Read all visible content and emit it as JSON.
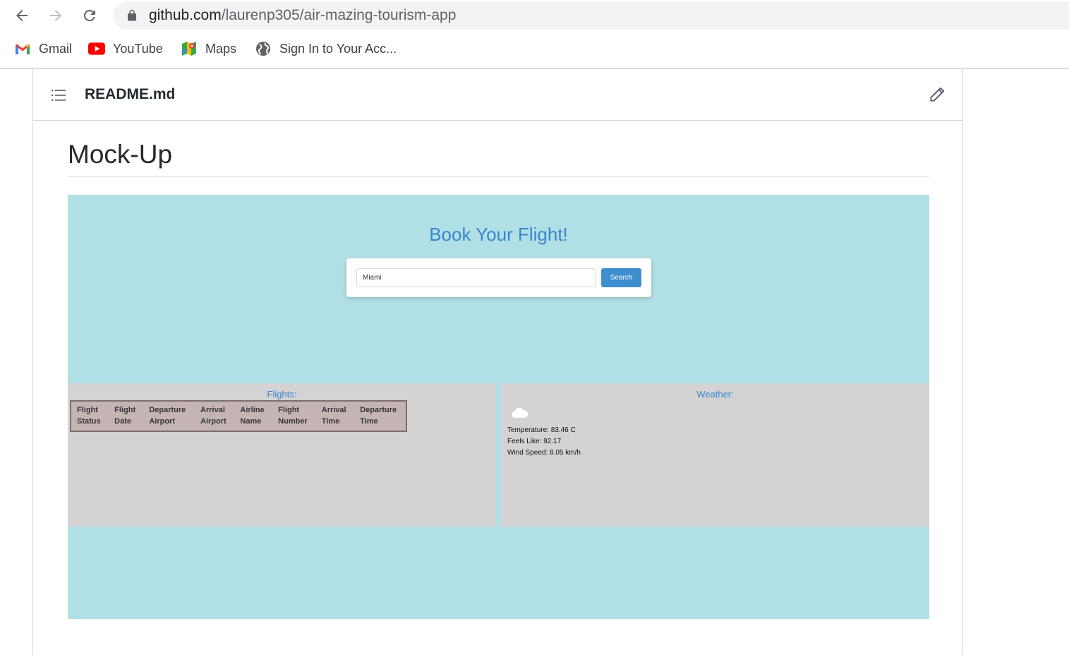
{
  "browser": {
    "url_domain": "github.com",
    "url_path": "/laurenp305/air-mazing-tourism-app",
    "bookmarks": [
      {
        "label": "Gmail",
        "icon": "gmail-icon"
      },
      {
        "label": "YouTube",
        "icon": "youtube-icon"
      },
      {
        "label": "Maps",
        "icon": "maps-icon"
      },
      {
        "label": "Sign In to Your Acc...",
        "icon": "globe-icon"
      }
    ]
  },
  "readme": {
    "filename": "README.md",
    "heading": "Mock-Up"
  },
  "mockup": {
    "title": "Book Your Flight!",
    "search_value": "Miami",
    "search_button": "Search",
    "flights_title": "Flights:",
    "flight_columns": [
      [
        "Flight",
        "Status"
      ],
      [
        "Flight",
        "Date"
      ],
      [
        "Departure",
        "Airport"
      ],
      [
        "Arrival",
        "Airport"
      ],
      [
        "Airline",
        "Name"
      ],
      [
        "Flight",
        "Number"
      ],
      [
        "Arrival",
        "Time"
      ],
      [
        "Departure",
        "Time"
      ]
    ],
    "weather_title": "Weather:",
    "weather_icon": "cloud-icon",
    "temperature": "Temperature: 83.46 C",
    "feels_like": "Feels Like: 92.17",
    "wind_speed": "Wind Speed: 8.05 km/h"
  },
  "colors": {
    "mock_background": "#b0dfe5",
    "accent_blue": "#3a86d0",
    "panel_gray": "#d3d3d3",
    "table_bg": "#c4b5b4"
  }
}
